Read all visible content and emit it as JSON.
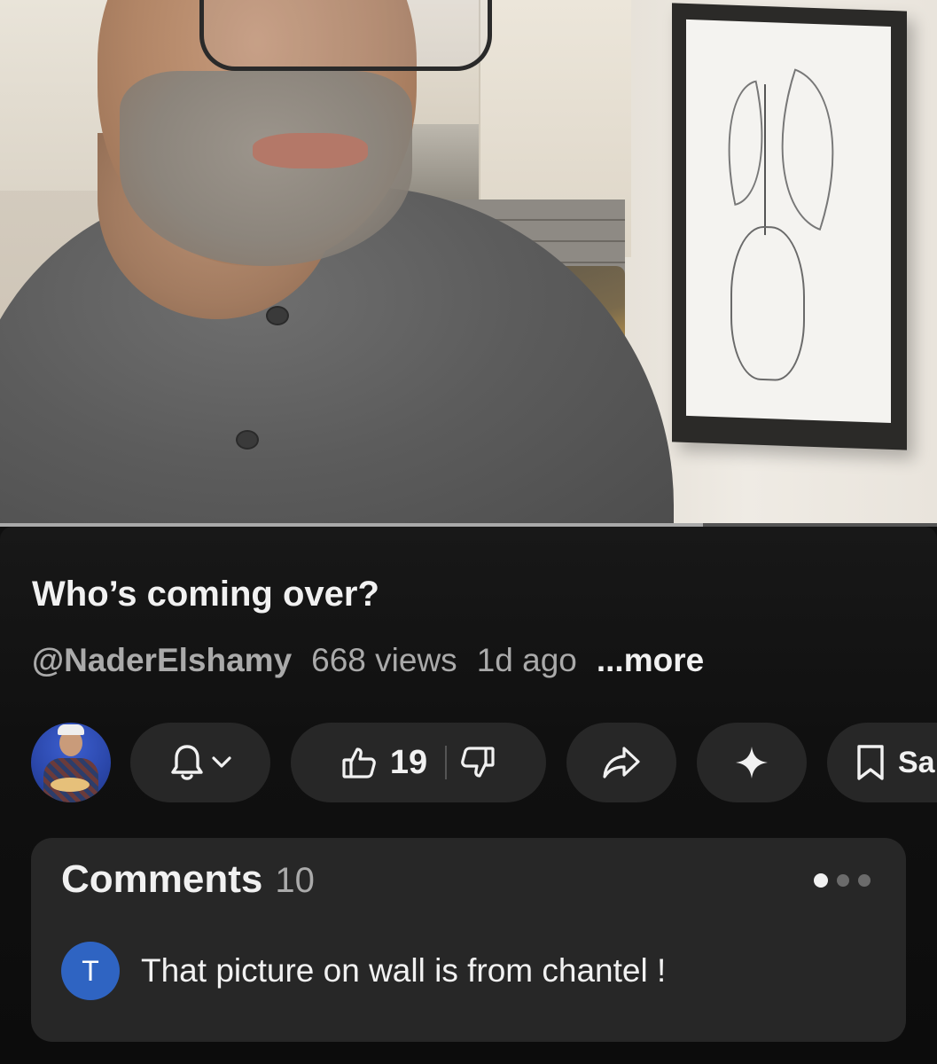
{
  "video": {
    "progress": 0.75
  },
  "info": {
    "title": "Who’s coming over?",
    "channel_handle": "@NaderElshamy",
    "views": "668 views",
    "age": "1d ago",
    "more_label": "...more"
  },
  "actions": {
    "like_count": "19",
    "save_label": "Sa"
  },
  "comments": {
    "title": "Comments",
    "count": "10",
    "pager": {
      "total": 3,
      "active_index": 0
    },
    "preview": {
      "avatar_letter": "T",
      "avatar_color": "#2f64c2",
      "text": "That picture on wall is from chantel !"
    }
  },
  "colors": {
    "background": "#0f0f0f",
    "pill": "#272727",
    "text": "#f1f1f1",
    "secondary_text": "#aaaaaa"
  },
  "icons": {
    "subscribe": "bell-icon",
    "subscribe_menu": "chevron-down-icon",
    "like": "thumbs-up-icon",
    "dislike": "thumbs-down-icon",
    "share": "share-arrow-icon",
    "ask": "sparkle-icon",
    "save": "bookmark-icon"
  }
}
